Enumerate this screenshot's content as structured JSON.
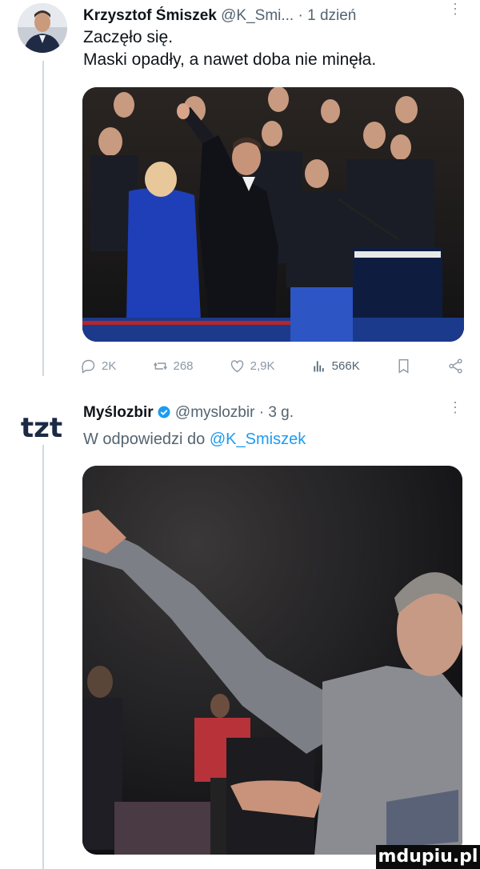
{
  "tweet1": {
    "author_name": "Krzysztof Śmiszek",
    "handle": "@K_Smi...",
    "time": "· 1 dzień",
    "line1": "Zaczęło się.",
    "line2": "Maski opadły, a nawet doba nie minęła.",
    "actions": {
      "replies": "2K",
      "reposts": "268",
      "likes": "2,9K",
      "views": "566K"
    }
  },
  "tweet2": {
    "author_name": "Myślozbir",
    "handle": "@myslozbir",
    "time": "· 3 g.",
    "reply_prefix": "W odpowiedzi do",
    "reply_to": "@K_Smiszek",
    "avatar_logo": "tzt"
  },
  "watermark": "mdupiu.pl",
  "colors": {
    "text": "#0f1419",
    "muted": "#536471",
    "link": "#1d9bf0",
    "verified": "#1d9bf0"
  }
}
